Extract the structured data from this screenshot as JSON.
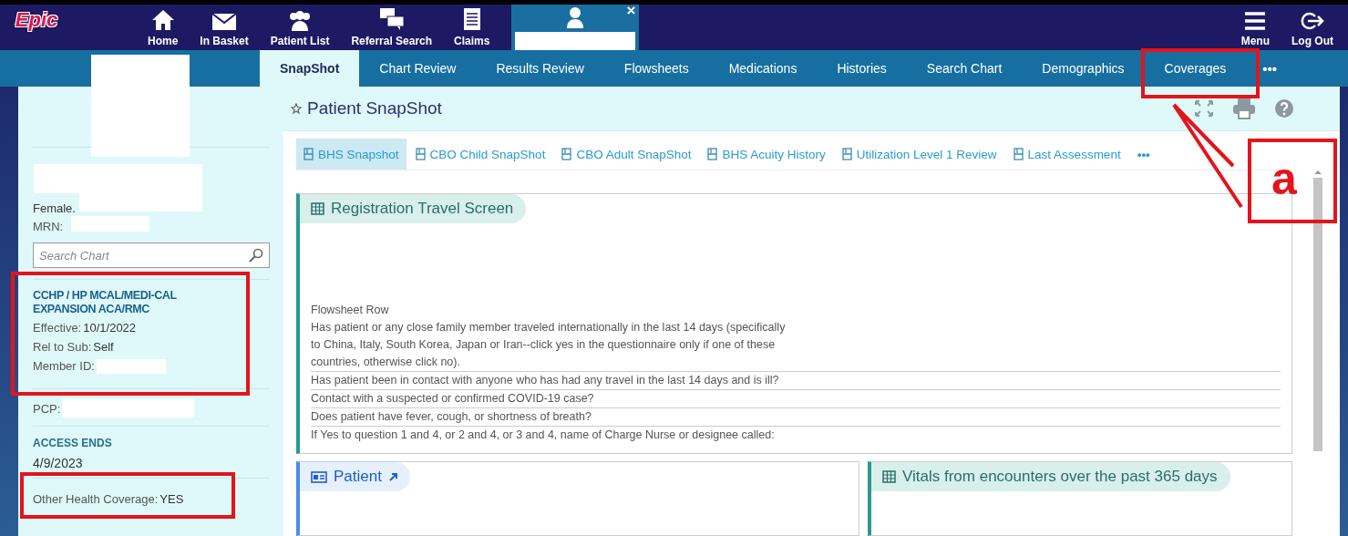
{
  "logo": "Epic",
  "top_nav": [
    {
      "label": "Home"
    },
    {
      "label": "In Basket"
    },
    {
      "label": "Patient List"
    },
    {
      "label": "Referral Search"
    },
    {
      "label": "Claims"
    }
  ],
  "patient_tab": {
    "close": "×"
  },
  "top_right": [
    {
      "label": "Menu"
    },
    {
      "label": "Log Out"
    }
  ],
  "tabs": [
    {
      "label": "SnapShot",
      "selected": true
    },
    {
      "label": "Chart Review",
      "selected": false
    },
    {
      "label": "Results Review",
      "selected": false
    },
    {
      "label": "Flowsheets",
      "selected": false
    },
    {
      "label": "Medications",
      "selected": false
    },
    {
      "label": "Histories",
      "selected": false
    },
    {
      "label": "Search Chart",
      "selected": false
    },
    {
      "label": "Demographics",
      "selected": false
    },
    {
      "label": "Coverages",
      "selected": false
    }
  ],
  "tabs_more": "•••",
  "sidebar": {
    "sex": "Female.",
    "mrn_label": "MRN:",
    "search": {
      "placeholder": "Search Chart"
    },
    "coverage": {
      "name": "CCHP / HP MCAL/MEDI-CAL EXPANSION ACA/RMC",
      "effective_label": "Effective:",
      "effective": "10/1/2022",
      "rel_label": "Rel to Sub:",
      "rel": "Self",
      "member_label": "Member ID:"
    },
    "pcp_label": "PCP:",
    "access_ends": {
      "label": "ACCESS ENDS",
      "date": "4/9/2023"
    },
    "other_coverage": {
      "label": "Other Health Coverage:",
      "value": "YES"
    }
  },
  "page_title": "Patient SnapShot",
  "report_tabs": [
    {
      "label": "BHS Snapshot",
      "selected": true
    },
    {
      "label": "CBO Child SnapShot",
      "selected": false
    },
    {
      "label": "CBO Adult SnapShot",
      "selected": false
    },
    {
      "label": "BHS Acuity History",
      "selected": false
    },
    {
      "label": "Utilization Level 1 Review",
      "selected": false
    },
    {
      "label": "Last Assessment",
      "selected": false
    }
  ],
  "report_tabs_more": "•••",
  "travel_screen": {
    "title": "Registration Travel Screen",
    "header": "Flowsheet Row",
    "rows": [
      "Has patient or any close family member traveled internationally in the last 14 days (specifically to China, Italy, South Korea, Japan or Iran--click yes in the questionnaire only if one of these countries, otherwise click no).",
      "Has patient been in contact with anyone who has had any travel in the last 14 days and is ill?",
      "Contact with a suspected or confirmed COVID-19 case?",
      "Does patient have fever, cough, or shortness of breath?",
      "If Yes to question 1 and 4, or 2 and 4, or 3 and 4, name of Charge Nurse or designee called:"
    ]
  },
  "cards": [
    {
      "kind": "patient",
      "title": "Patient"
    },
    {
      "kind": "vitals",
      "title": "Vitals from encounters over the past 365 days"
    }
  ],
  "annotation": {
    "label": "a"
  }
}
